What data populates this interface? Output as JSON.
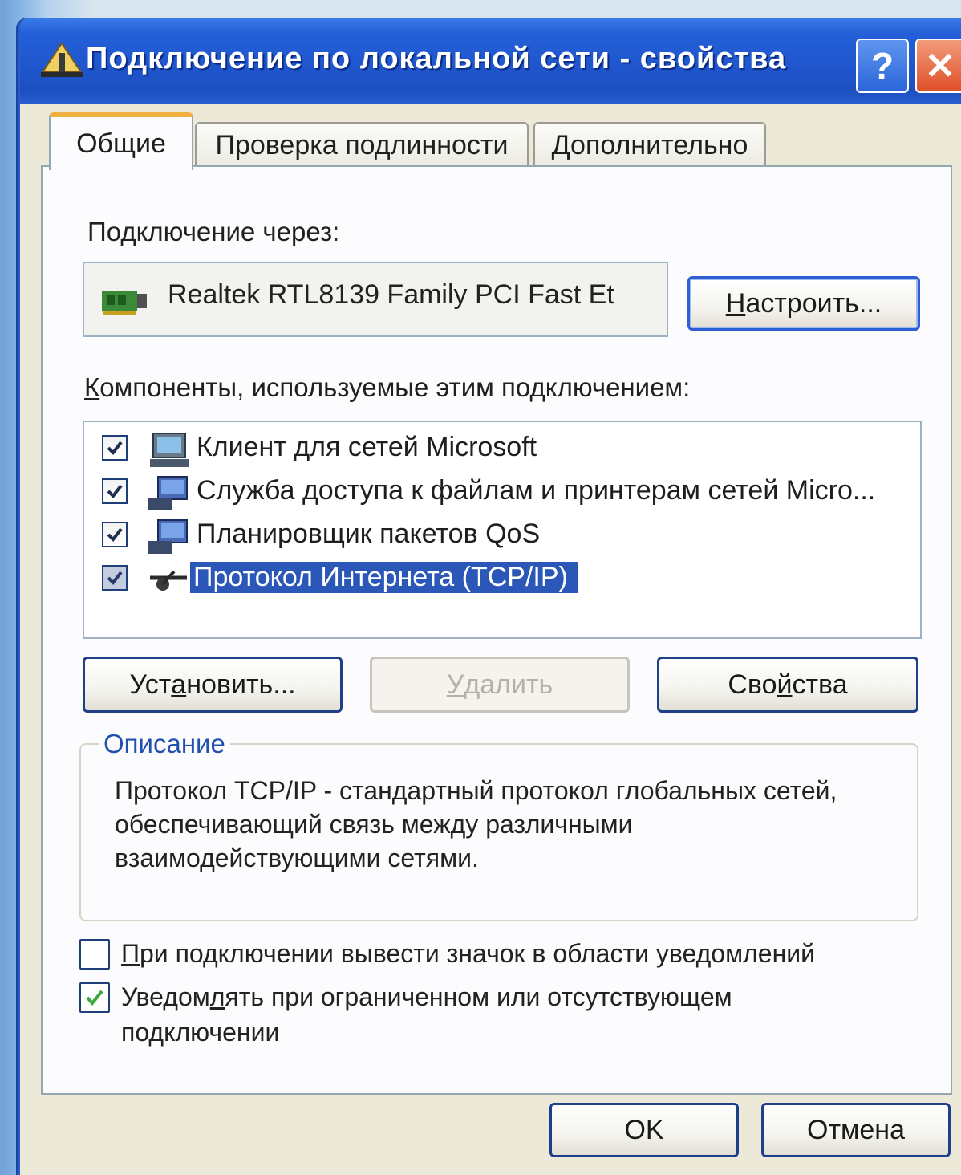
{
  "window": {
    "title": "Подключение по локальной сети - свойства",
    "help_label": "?",
    "close_label": "✕"
  },
  "tabs": [
    {
      "label": "Общие",
      "active": true
    },
    {
      "label": "Проверка подлинности",
      "active": false
    },
    {
      "label": "Дополнительно",
      "active": false
    }
  ],
  "general": {
    "connect_via_label": "Подключение через:",
    "adapter_name": "Realtek RTL8139 Family PCI Fast Et",
    "configure_button": {
      "prefix": "Н",
      "rest": "астроить..."
    },
    "components_label": {
      "prefix": "К",
      "rest": "омпоненты, используемые этим подключением:"
    },
    "components": [
      {
        "label": "Клиент для сетей Microsoft",
        "checked": true,
        "icon": "network-client-icon",
        "selected": false
      },
      {
        "label": "Служба доступа к файлам и принтерам сетей Micro...",
        "checked": true,
        "icon": "network-service-icon",
        "selected": false
      },
      {
        "label": "Планировщик пакетов QoS",
        "checked": true,
        "icon": "network-service-icon",
        "selected": false
      },
      {
        "label": "Протокол Интернета (TCP/IP)",
        "checked": true,
        "icon": "network-protocol-icon",
        "selected": true
      }
    ],
    "install_button": {
      "a": "Уст",
      "b": "а",
      "c": "новить..."
    },
    "remove_button": {
      "prefix": "У",
      "rest": "далить"
    },
    "properties_button": {
      "a": "Сво",
      "b": "й",
      "c": "ства"
    },
    "description_legend": "Описание",
    "description_text": "Протокол TCP/IP - стандартный протокол глобальных сетей, обеспечивающий связь между различными взаимодействующими сетями.",
    "show_icon_option": {
      "prefix": "П",
      "rest": "ри подключении вывести значок в области уведомлений",
      "checked": false
    },
    "notify_option": {
      "a": "Уведом",
      "b": "л",
      "c": "ять при ограниченном или отсутствующем",
      "line2": "подключении",
      "checked": true
    }
  },
  "footer": {
    "ok_label": "OK",
    "cancel_label": "Отмена"
  },
  "colors": {
    "titlebar": "#1f55cc",
    "selection": "#2b58b8",
    "legend": "#2250b0"
  }
}
